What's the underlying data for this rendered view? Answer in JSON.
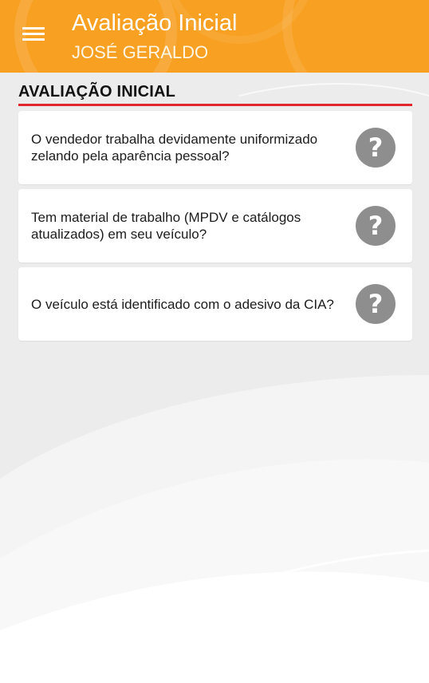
{
  "colors": {
    "app_bar": "#f8a021",
    "accent_line": "#e3262b",
    "card_bg": "#ffffff",
    "page_bg": "#ececec",
    "help_icon": "#8e8e8e"
  },
  "app_bar": {
    "menu_icon": "hamburger-menu-icon",
    "title": "Avaliação Inicial",
    "subtitle": "JOSÉ GERALDO"
  },
  "section": {
    "title": "AVALIAÇÃO INICIAL"
  },
  "questions": [
    {
      "text": "O vendedor trabalha devidamente uniformizado zelando pela aparência pessoal?",
      "icon": "question-mark-icon"
    },
    {
      "text": "Tem material de trabalho (MPDV e catálogos atualizados) em seu veículo?",
      "icon": "question-mark-icon"
    },
    {
      "text": "O veículo está identificado com o adesivo da CIA?",
      "icon": "question-mark-icon"
    }
  ]
}
